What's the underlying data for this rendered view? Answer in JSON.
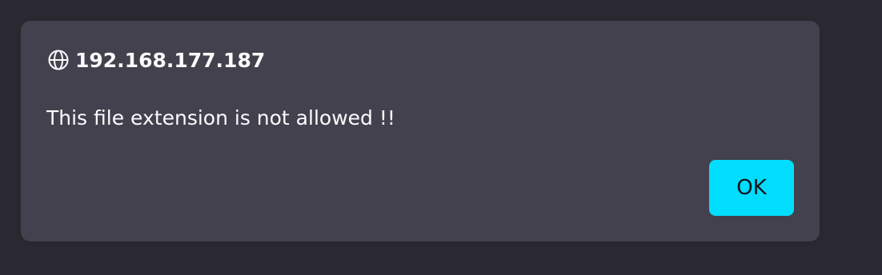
{
  "dialog": {
    "origin": "192.168.177.187",
    "origin_icon": "globe-icon",
    "message": "This file extension is not allowed !!",
    "ok_label": "OK"
  },
  "colors": {
    "background": "#2b2a33",
    "dialog_background": "#42414d",
    "text": "#fbfbfe",
    "accent": "#00ddff",
    "button_text": "#15141a"
  }
}
